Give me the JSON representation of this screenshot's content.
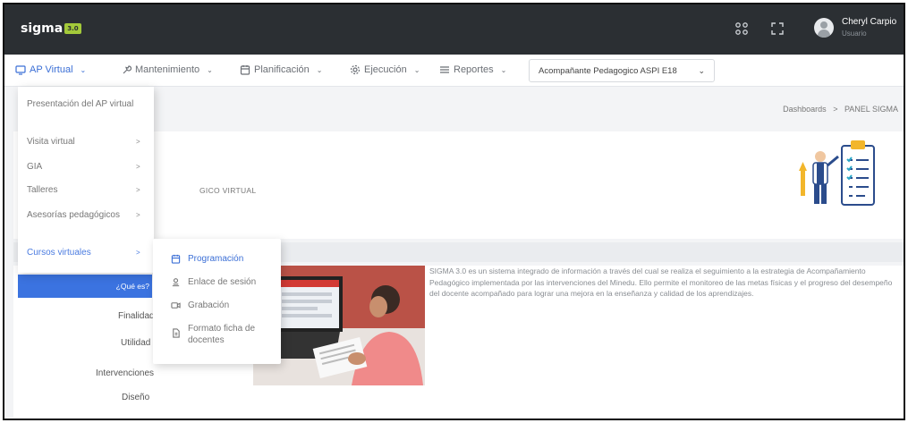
{
  "app": {
    "logo_text": "sigma",
    "logo_badge": "3.0"
  },
  "user": {
    "name": "Cheryl Carpio",
    "role": "Usuario"
  },
  "menubar": {
    "items": [
      {
        "label": "AP Virtual",
        "icon": "monitor-icon"
      },
      {
        "label": "Mantenimiento",
        "icon": "tools-icon"
      },
      {
        "label": "Planificación",
        "icon": "calendar-icon"
      },
      {
        "label": "Ejecución",
        "icon": "gear-icon"
      },
      {
        "label": "Reportes",
        "icon": "list-icon"
      }
    ],
    "select_value": "Acompañante Pedagogico ASPI E18"
  },
  "breadcrumb": {
    "first": "Dashboards",
    "separator": ">",
    "second": "PANEL SIGMA"
  },
  "card1": {
    "title_partial": "GICO VIRTUAL"
  },
  "card2": {
    "description": "SIGMA 3.0 es un sistema integrado de información a través del cual se realiza el seguimiento a la estrategia de Acompañamiento Pedagógico implementada por las intervenciones del Minedu. Ello permite el monitoreo de las metas físicas y el progreso del desempeño del docente acompañado para lograr una mejora en la enseñanza y calidad de los aprendizajes."
  },
  "dropdown": {
    "items": [
      {
        "label": "Presentación del AP virtual",
        "has_arrow": false
      },
      {
        "label": "Visita virtual",
        "has_arrow": true
      },
      {
        "label": "GIA",
        "has_arrow": true
      },
      {
        "label": "Talleres",
        "has_arrow": true
      },
      {
        "label": "Asesorías pedagógicos",
        "has_arrow": true
      },
      {
        "label": "Cursos virtuales",
        "has_arrow": true
      }
    ],
    "arrow_glyph": ">"
  },
  "sidebar_links": {
    "que_es": "¿Qué es?",
    "finalidad": "Finalidad",
    "utilidad": "Utilidad",
    "intervenciones": "Intervenciones",
    "diseno": "Diseño"
  },
  "submenu": {
    "items": [
      {
        "label": "Programación",
        "icon": "calendar-icon"
      },
      {
        "label": "Enlace de sesión",
        "icon": "user-link-icon"
      },
      {
        "label": "Grabación",
        "icon": "video-icon"
      },
      {
        "label": "Formato ficha de docentes",
        "icon": "document-icon"
      }
    ]
  },
  "colors": {
    "topbar": "#2b2f33",
    "accent": "#3b6fd6",
    "logo_badge": "#a3c93a"
  }
}
